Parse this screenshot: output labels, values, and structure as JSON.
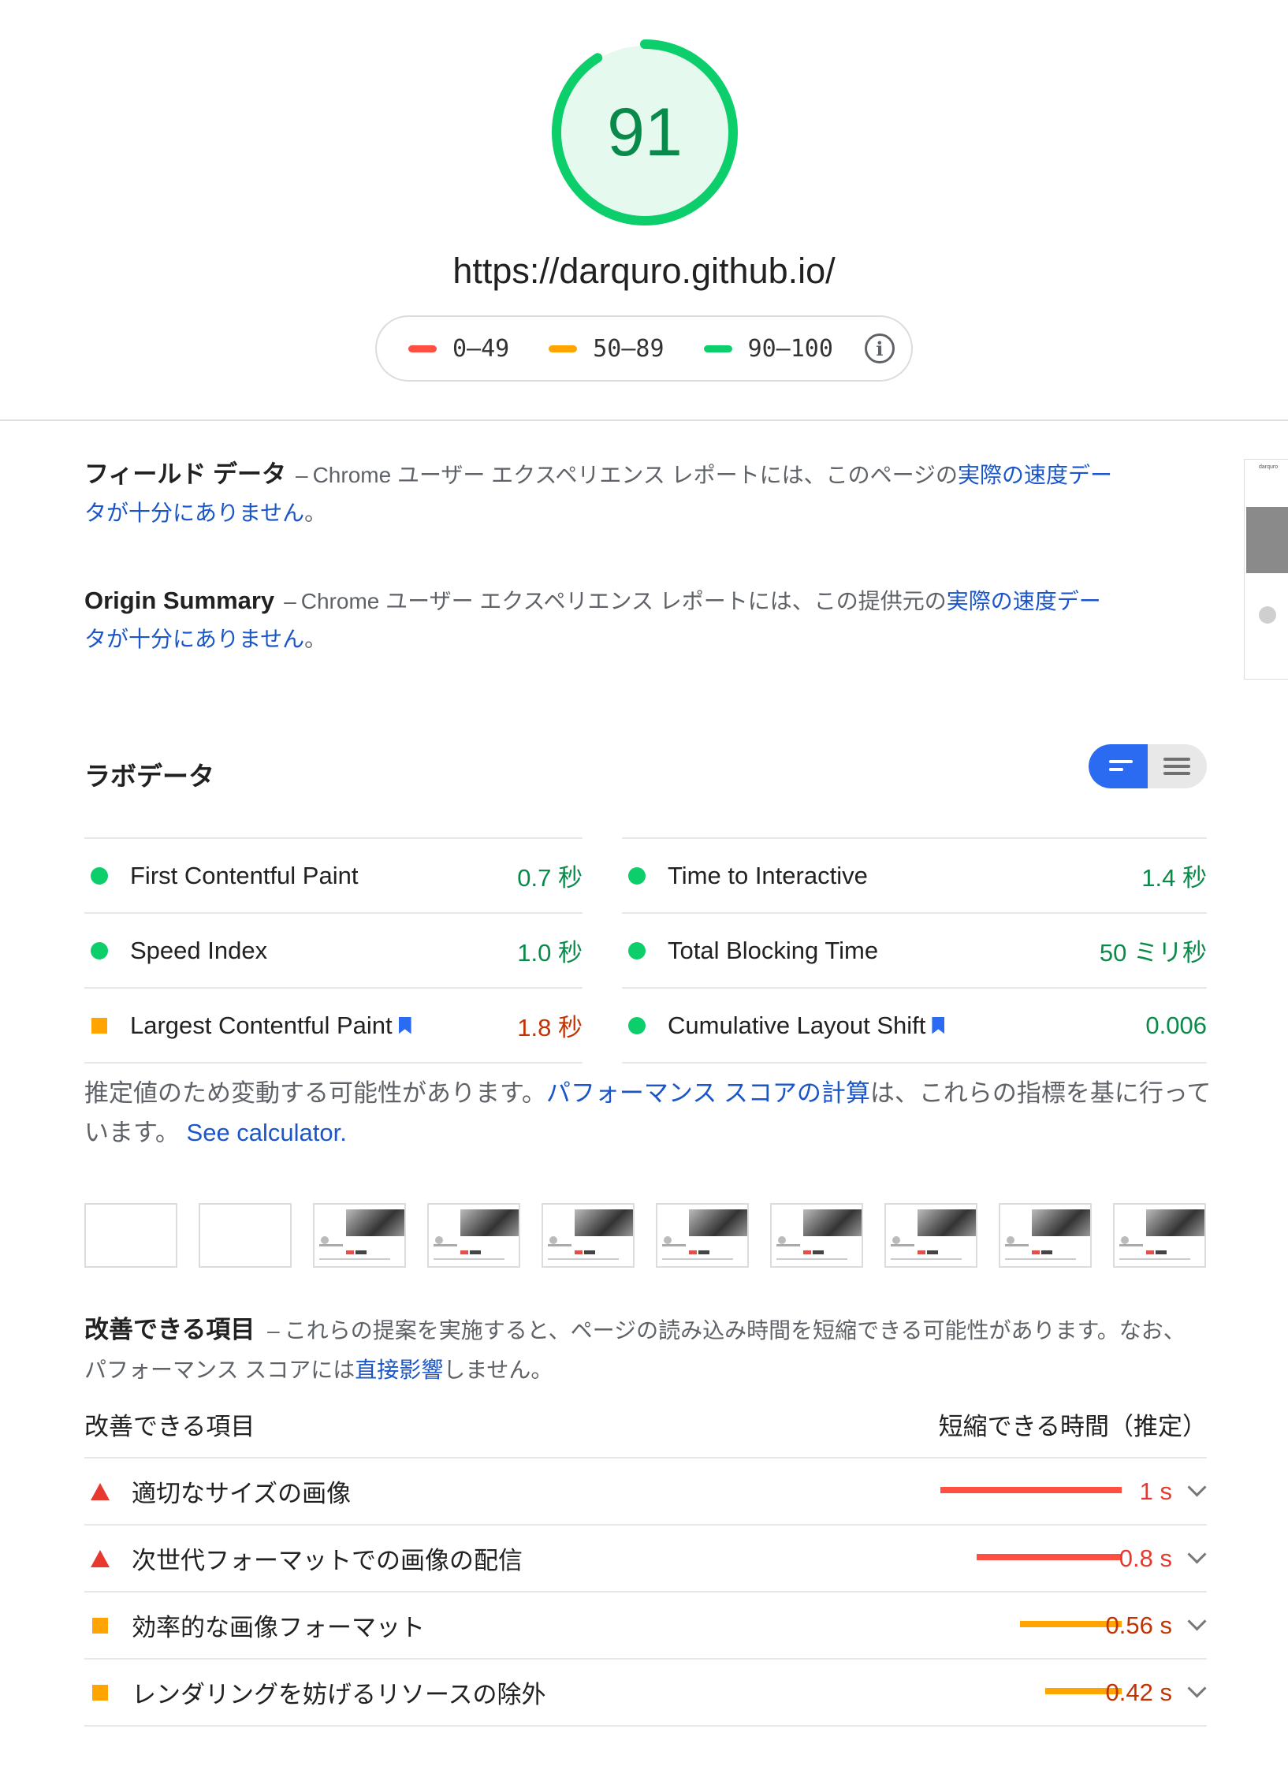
{
  "score": {
    "value": "91",
    "fraction": 0.91,
    "color": "#0cce6b",
    "bg": "#e6f9ee"
  },
  "url": "https://darquro.github.io/",
  "legend": [
    {
      "label": "0–49",
      "color": "#ff4e42"
    },
    {
      "label": "50–89",
      "color": "#ffa400"
    },
    {
      "label": "90–100",
      "color": "#0cce6b"
    }
  ],
  "field_data": {
    "title": "フィールド データ",
    "sep": "–",
    "text": "Chrome ユーザー エクスペリエンス レポートには、このページの",
    "link": "実際の速度データが十分にありません",
    "end": "。"
  },
  "origin_summary": {
    "title": "Origin Summary",
    "sep": "–",
    "text": "Chrome ユーザー エクスペリエンス レポートには、この提供元の",
    "link": "実際の速度データが十分にありません",
    "end": "。"
  },
  "thumbnail": {
    "title": "darquro"
  },
  "lab": {
    "title": "ラボデータ"
  },
  "metrics": {
    "left": [
      {
        "name": "First Contentful Paint",
        "value": "0.7 秒",
        "status": "pass"
      },
      {
        "name": "Speed Index",
        "value": "1.0 秒",
        "status": "pass"
      },
      {
        "name": "Largest Contentful Paint",
        "value": "1.8 秒",
        "status": "average"
      }
    ],
    "right": [
      {
        "name": "Time to Interactive",
        "value": "1.4 秒",
        "status": "pass"
      },
      {
        "name": "Total Blocking Time",
        "value": "50 ミリ秒",
        "status": "pass"
      },
      {
        "name": "Cumulative Layout Shift",
        "value": "0.006",
        "status": "pass"
      }
    ]
  },
  "colors": {
    "pass": "#0cce6b",
    "pass_text": "#0a8a4a",
    "average": "#ffa400",
    "average_text": "#c33300",
    "fail": "#ff4e42",
    "fail_text": "#e8392f",
    "link": "#1a56c9"
  },
  "note": {
    "text1": "推定値のため変動する可能性があります。",
    "link1": "パフォーマンス スコアの計算",
    "text2": "は、これらの指標を基に行っています。",
    "link2": "See calculator."
  },
  "opportunities_intro": {
    "title": "改善できる項目",
    "sep": "–",
    "text1": "これらの提案を実施すると、ページの読み込み時間を短縮できる可能性があります。なお、パフォーマンス スコアには",
    "link": "直接影響",
    "text2": "しません。"
  },
  "opportunities_header": {
    "left": "改善できる項目",
    "right": "短縮できる時間（推定）"
  },
  "opportunities": [
    {
      "name": "適切なサイズの画像",
      "savings": "1 s",
      "level": "fail",
      "bar_fraction": 1.0
    },
    {
      "name": "次世代フォーマットでの画像の配信",
      "savings": "0.8 s",
      "level": "fail",
      "bar_fraction": 0.8
    },
    {
      "name": "効率的な画像フォーマット",
      "savings": "0.56 s",
      "level": "average",
      "bar_fraction": 0.56
    },
    {
      "name": "レンダリングを妨げるリソースの除外",
      "savings": "0.42 s",
      "level": "average",
      "bar_fraction": 0.42
    }
  ]
}
